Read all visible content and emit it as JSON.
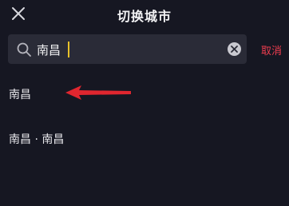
{
  "header": {
    "title": "切换城市",
    "close_icon": "close-icon"
  },
  "search": {
    "value": "南昌",
    "search_icon": "search-icon",
    "clear_icon": "clear-icon",
    "cancel_label": "取消"
  },
  "results": [
    {
      "label": "南昌"
    },
    {
      "label": "南昌 · 南昌"
    }
  ],
  "colors": {
    "background": "#161722",
    "search_bg": "#2a2b37",
    "accent_red": "#ee3d4f",
    "caret": "#e8c22a",
    "text": "#e8e8ec"
  },
  "annotation": {
    "arrow_icon": "red-arrow-icon",
    "arrow_color": "#e0262f"
  }
}
